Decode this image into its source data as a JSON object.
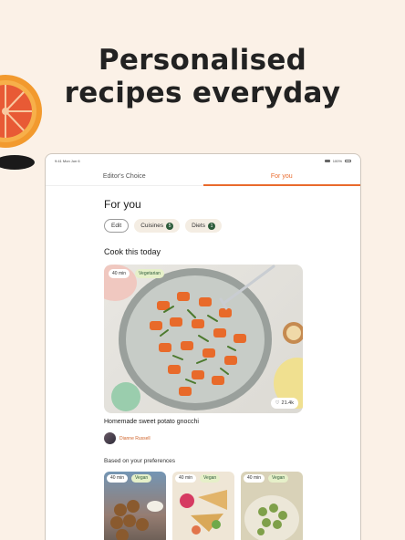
{
  "headline": {
    "line1": "Personalised",
    "line2": "recipes everyday"
  },
  "status_bar": {
    "time": "9:41 Mon Jun 6",
    "battery": "100%"
  },
  "tabs": [
    {
      "label": "Editor's Choice",
      "active": false
    },
    {
      "label": "For you",
      "active": true
    }
  ],
  "section_title": "For you",
  "filters": {
    "edit": "Edit",
    "cuisines": {
      "label": "Cuisines",
      "count": "5"
    },
    "diets": {
      "label": "Diets",
      "count": "1"
    }
  },
  "cook_today": {
    "title": "Cook this today",
    "time_tag": "40 min",
    "diet_tag": "Vegetarian",
    "likes": "21.4k",
    "recipe_name": "Homemade sweet potato gnocchi",
    "author": "Dianne Russell"
  },
  "preferences": {
    "title": "Based on your preferences",
    "cards": [
      {
        "time": "40 min",
        "tag": "Vegan"
      },
      {
        "time": "40 min",
        "tag": "Vegan"
      },
      {
        "time": "40 min",
        "tag": "Vegan"
      }
    ]
  },
  "colors": {
    "accent": "#e96a2c",
    "background": "#fbf1e7",
    "badge_green": "#2d5b3a",
    "tag_green": "#e6f0c9"
  },
  "icons": [
    "grapefruit-illustration",
    "heart-icon",
    "signal-icon",
    "battery-icon"
  ]
}
